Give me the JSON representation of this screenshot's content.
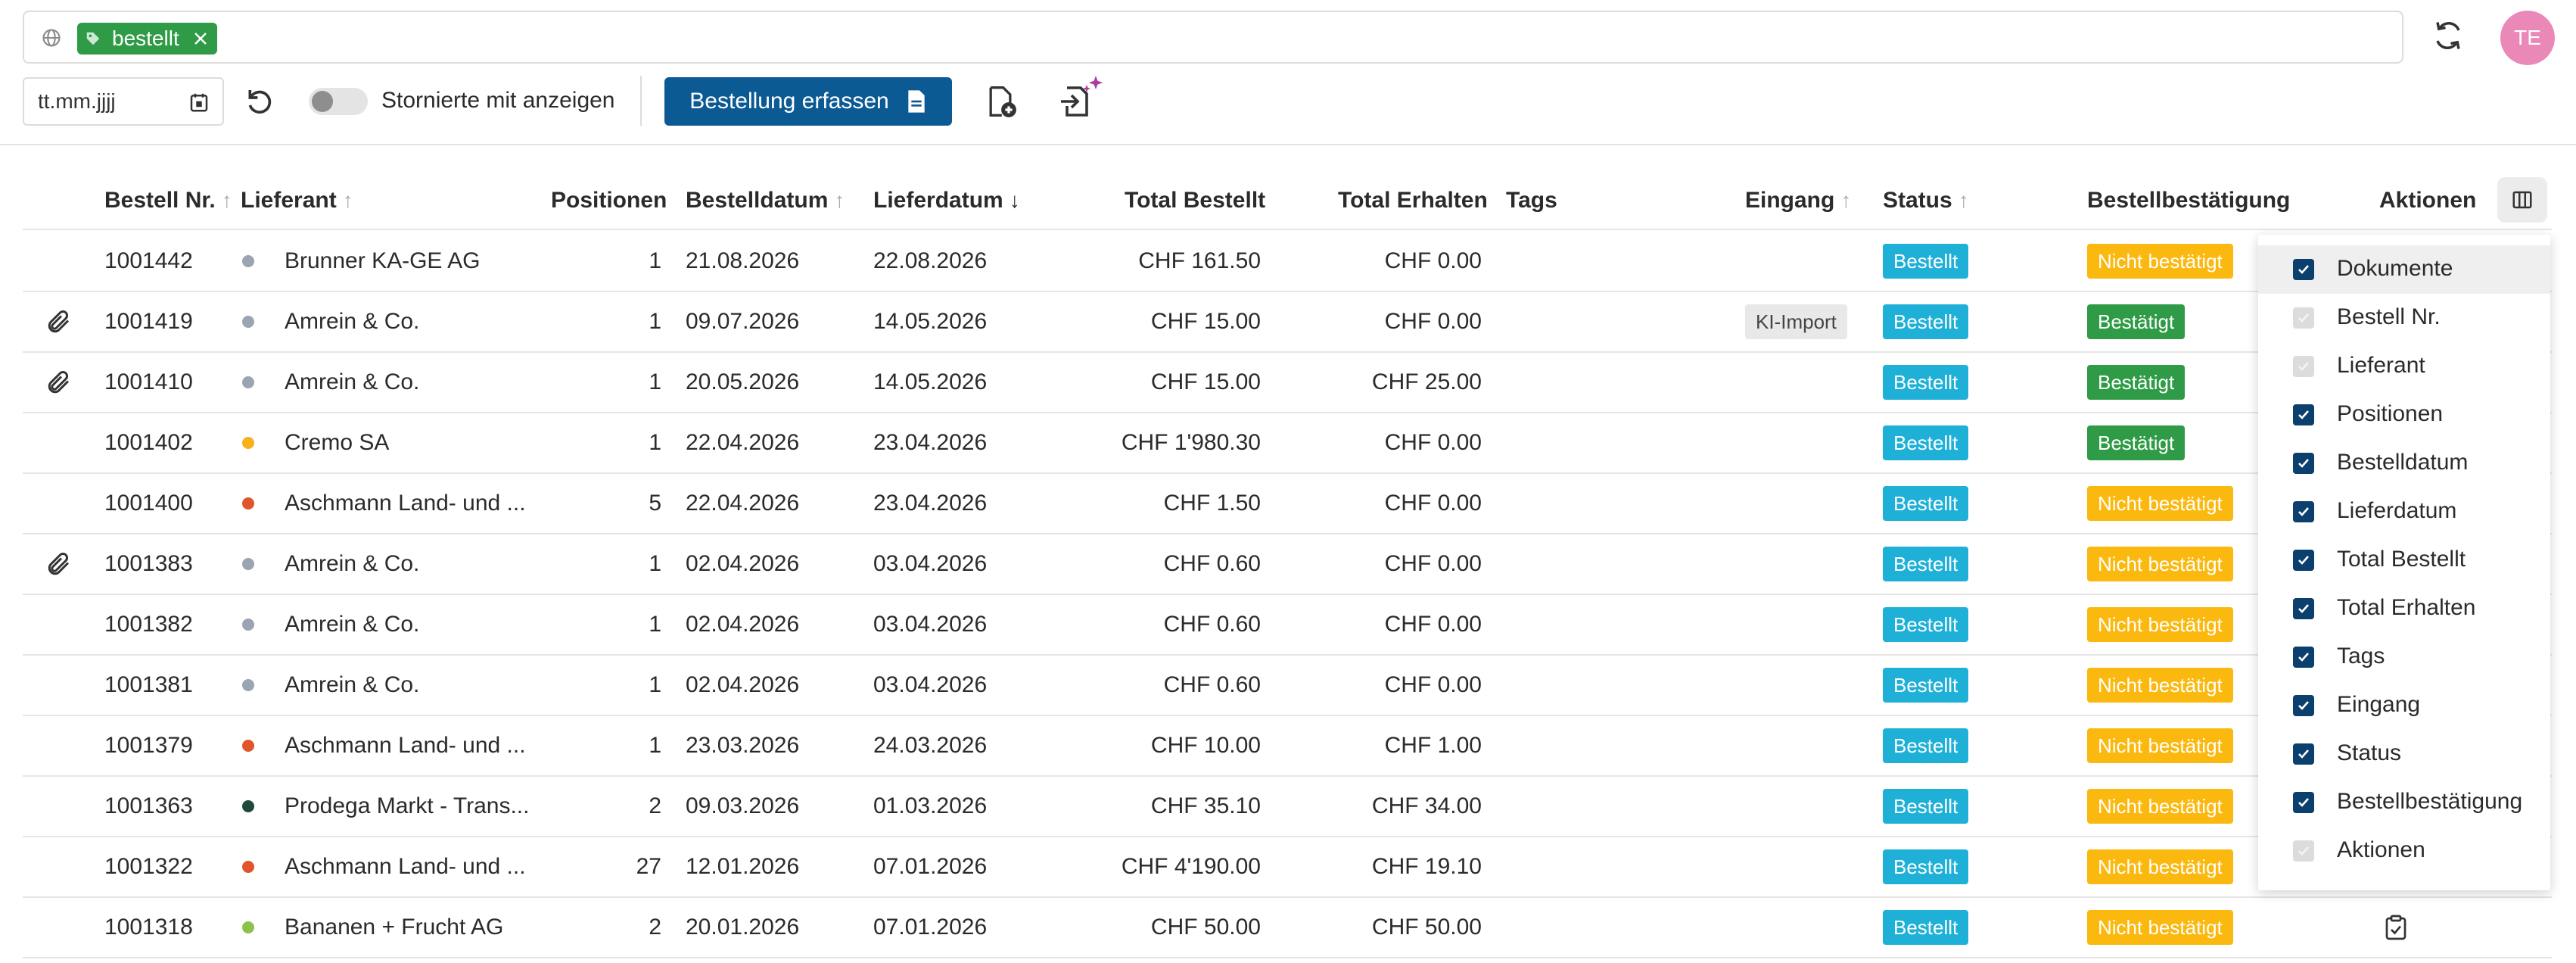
{
  "search": {
    "icon": "globe-icon",
    "chip_label": "bestellt",
    "chip_color": "#2f9b46"
  },
  "user": {
    "initials": "TE",
    "avatar_color": "#ea89b8"
  },
  "toolbar": {
    "date_placeholder": "tt.mm.jjjj",
    "toggle_label": "Stornierte mit anzeigen",
    "toggle_on": false,
    "primary_button": "Bestellung erfassen",
    "primary_color": "#0b5a93"
  },
  "table": {
    "headers": {
      "bestell_nr": "Bestell Nr.",
      "lieferant": "Lieferant",
      "positionen": "Positionen",
      "bestelldatum": "Bestelldatum",
      "lieferdatum": "Lieferdatum",
      "total_bestellt": "Total Bestellt",
      "total_erhalten": "Total Erhalten",
      "tags": "Tags",
      "eingang": "Eingang",
      "status": "Status",
      "bestaetigung": "Bestellbestätigung",
      "aktionen": "Aktionen"
    },
    "sort": {
      "column": "Lieferdatum",
      "direction": "descending"
    },
    "rows": [
      {
        "attachment": false,
        "nr": "1001442",
        "dot": "#9aa5b1",
        "lieferant": "Brunner KA-GE AG",
        "positionen": "1",
        "bestelldatum": "21.08.2026",
        "lieferdatum": "22.08.2026",
        "total_bestellt": "CHF 161.50",
        "total_erhalten": "CHF 0.00",
        "eingang": "",
        "status": "Bestellt",
        "bestaetigung": "Nicht bestätigt",
        "bestaetigung_color": "orange",
        "action": false
      },
      {
        "attachment": true,
        "nr": "1001419",
        "dot": "#9aa5b1",
        "lieferant": "Amrein & Co.",
        "positionen": "1",
        "bestelldatum": "09.07.2026",
        "lieferdatum": "14.05.2026",
        "total_bestellt": "CHF 15.00",
        "total_erhalten": "CHF 0.00",
        "eingang": "KI-Import",
        "status": "Bestellt",
        "bestaetigung": "Bestätigt",
        "bestaetigung_color": "green",
        "action": false
      },
      {
        "attachment": true,
        "nr": "1001410",
        "dot": "#9aa5b1",
        "lieferant": "Amrein & Co.",
        "positionen": "1",
        "bestelldatum": "20.05.2026",
        "lieferdatum": "14.05.2026",
        "total_bestellt": "CHF 15.00",
        "total_erhalten": "CHF 25.00",
        "eingang": "",
        "status": "Bestellt",
        "bestaetigung": "Bestätigt",
        "bestaetigung_color": "green",
        "action": false
      },
      {
        "attachment": false,
        "nr": "1001402",
        "dot": "#f5b21d",
        "lieferant": "Cremo SA",
        "positionen": "1",
        "bestelldatum": "22.04.2026",
        "lieferdatum": "23.04.2026",
        "total_bestellt": "CHF 1'980.30",
        "total_erhalten": "CHF 0.00",
        "eingang": "",
        "status": "Bestellt",
        "bestaetigung": "Bestätigt",
        "bestaetigung_color": "green",
        "action": false
      },
      {
        "attachment": false,
        "nr": "1001400",
        "dot": "#e0552b",
        "lieferant": "Aschmann Land- und ...",
        "positionen": "5",
        "bestelldatum": "22.04.2026",
        "lieferdatum": "23.04.2026",
        "total_bestellt": "CHF 1.50",
        "total_erhalten": "CHF 0.00",
        "eingang": "",
        "status": "Bestellt",
        "bestaetigung": "Nicht bestätigt",
        "bestaetigung_color": "orange",
        "action": false
      },
      {
        "attachment": true,
        "nr": "1001383",
        "dot": "#9aa5b1",
        "lieferant": "Amrein & Co.",
        "positionen": "1",
        "bestelldatum": "02.04.2026",
        "lieferdatum": "03.04.2026",
        "total_bestellt": "CHF 0.60",
        "total_erhalten": "CHF 0.00",
        "eingang": "",
        "status": "Bestellt",
        "bestaetigung": "Nicht bestätigt",
        "bestaetigung_color": "orange",
        "action": false
      },
      {
        "attachment": false,
        "nr": "1001382",
        "dot": "#9aa5b1",
        "lieferant": "Amrein & Co.",
        "positionen": "1",
        "bestelldatum": "02.04.2026",
        "lieferdatum": "03.04.2026",
        "total_bestellt": "CHF 0.60",
        "total_erhalten": "CHF 0.00",
        "eingang": "",
        "status": "Bestellt",
        "bestaetigung": "Nicht bestätigt",
        "bestaetigung_color": "orange",
        "action": false
      },
      {
        "attachment": false,
        "nr": "1001381",
        "dot": "#9aa5b1",
        "lieferant": "Amrein & Co.",
        "positionen": "1",
        "bestelldatum": "02.04.2026",
        "lieferdatum": "03.04.2026",
        "total_bestellt": "CHF 0.60",
        "total_erhalten": "CHF 0.00",
        "eingang": "",
        "status": "Bestellt",
        "bestaetigung": "Nicht bestätigt",
        "bestaetigung_color": "orange",
        "action": false
      },
      {
        "attachment": false,
        "nr": "1001379",
        "dot": "#e0552b",
        "lieferant": "Aschmann Land- und ...",
        "positionen": "1",
        "bestelldatum": "23.03.2026",
        "lieferdatum": "24.03.2026",
        "total_bestellt": "CHF 10.00",
        "total_erhalten": "CHF 1.00",
        "eingang": "",
        "status": "Bestellt",
        "bestaetigung": "Nicht bestätigt",
        "bestaetigung_color": "orange",
        "action": false
      },
      {
        "attachment": false,
        "nr": "1001363",
        "dot": "#1f4a3a",
        "lieferant": "Prodega Markt - Trans...",
        "positionen": "2",
        "bestelldatum": "09.03.2026",
        "lieferdatum": "01.03.2026",
        "total_bestellt": "CHF 35.10",
        "total_erhalten": "CHF 34.00",
        "eingang": "",
        "status": "Bestellt",
        "bestaetigung": "Nicht bestätigt",
        "bestaetigung_color": "orange",
        "action": false
      },
      {
        "attachment": false,
        "nr": "1001322",
        "dot": "#e0552b",
        "lieferant": "Aschmann Land- und ...",
        "positionen": "27",
        "bestelldatum": "12.01.2026",
        "lieferdatum": "07.01.2026",
        "total_bestellt": "CHF 4'190.00",
        "total_erhalten": "CHF 19.10",
        "eingang": "",
        "status": "Bestellt",
        "bestaetigung": "Nicht bestätigt",
        "bestaetigung_color": "orange",
        "action": false
      },
      {
        "attachment": false,
        "nr": "1001318",
        "dot": "#8bc34a",
        "lieferant": "Bananen + Frucht AG",
        "positionen": "2",
        "bestelldatum": "20.01.2026",
        "lieferdatum": "07.01.2026",
        "total_bestellt": "CHF 50.00",
        "total_erhalten": "CHF 50.00",
        "eingang": "",
        "status": "Bestellt",
        "bestaetigung": "Nicht bestätigt",
        "bestaetigung_color": "orange",
        "action": true
      }
    ]
  },
  "column_picker": {
    "items": [
      {
        "label": "Dokumente",
        "checked": true,
        "disabled": false
      },
      {
        "label": "Bestell Nr.",
        "checked": true,
        "disabled": true
      },
      {
        "label": "Lieferant",
        "checked": true,
        "disabled": true
      },
      {
        "label": "Positionen",
        "checked": true,
        "disabled": false
      },
      {
        "label": "Bestelldatum",
        "checked": true,
        "disabled": false
      },
      {
        "label": "Lieferdatum",
        "checked": true,
        "disabled": false
      },
      {
        "label": "Total Bestellt",
        "checked": true,
        "disabled": false
      },
      {
        "label": "Total Erhalten",
        "checked": true,
        "disabled": false
      },
      {
        "label": "Tags",
        "checked": true,
        "disabled": false
      },
      {
        "label": "Eingang",
        "checked": true,
        "disabled": false
      },
      {
        "label": "Status",
        "checked": true,
        "disabled": false
      },
      {
        "label": "Bestellbestätigung",
        "checked": true,
        "disabled": false
      },
      {
        "label": "Aktionen",
        "checked": true,
        "disabled": true
      }
    ]
  }
}
